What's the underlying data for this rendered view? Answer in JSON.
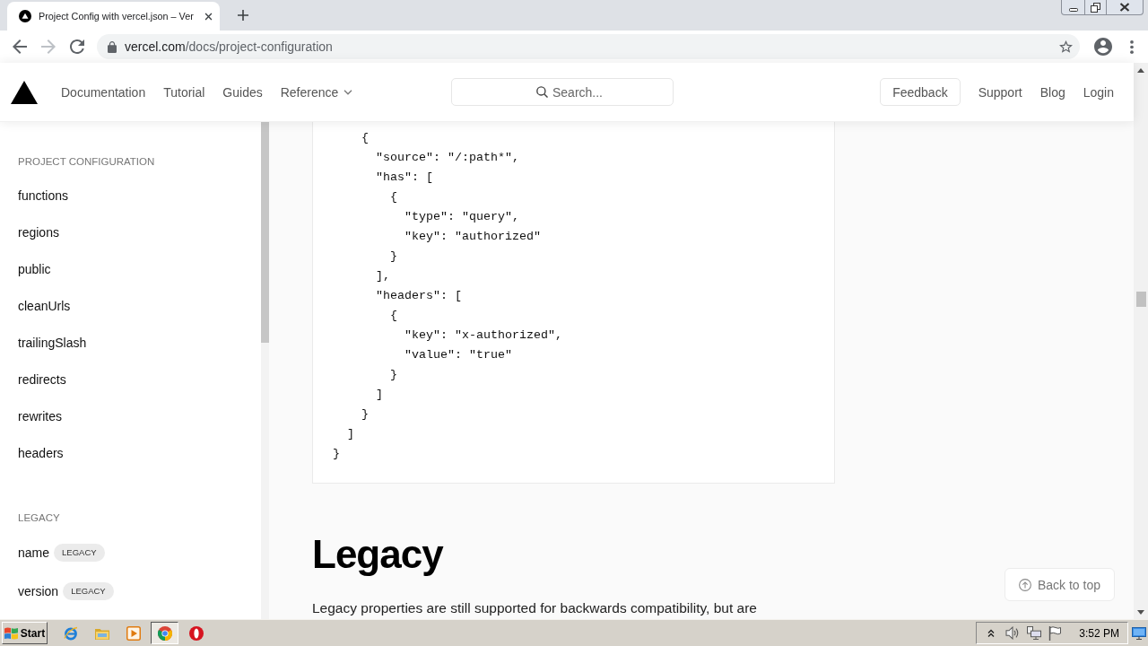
{
  "browser": {
    "tabs": [
      {
        "title": "Project Config with vercel.json – Ver",
        "selected": true
      }
    ],
    "nav_buttons": [
      {
        "disabled": false
      },
      {
        "disabled": true
      },
      {
        "disabled": false
      }
    ],
    "address": {
      "host": "vercel.com",
      "path": "/docs/project-configuration"
    }
  },
  "header": {
    "nav": [
      {
        "label": "Documentation",
        "dropdown": false
      },
      {
        "label": "Tutorial",
        "dropdown": false
      },
      {
        "label": "Guides",
        "dropdown": false
      },
      {
        "label": "Reference",
        "dropdown": true
      }
    ],
    "search": {
      "placeholder": "Search..."
    },
    "feedback": "Feedback",
    "links": [
      "Support",
      "Blog",
      "Login"
    ]
  },
  "sidebar": {
    "sections": [
      {
        "heading": "PROJECT CONFIGURATION",
        "items": [
          {
            "label": "functions"
          },
          {
            "label": "regions"
          },
          {
            "label": "public"
          },
          {
            "label": "cleanUrls"
          },
          {
            "label": "trailingSlash"
          },
          {
            "label": "redirects"
          },
          {
            "label": "rewrites"
          },
          {
            "label": "headers"
          }
        ]
      },
      {
        "heading": "LEGACY",
        "items": [
          {
            "label": "name",
            "badge": "LEGACY"
          },
          {
            "label": "version",
            "badge": "LEGACY"
          }
        ]
      }
    ]
  },
  "content": {
    "code_lines": [
      "    {",
      "      \"source\": \"/:path*\",",
      "      \"has\": [",
      "        {",
      "          \"type\": \"query\",",
      "          \"key\": \"authorized\"",
      "        }",
      "      ],",
      "      \"headers\": [",
      "        {",
      "          \"key\": \"x-authorized\",",
      "          \"value\": \"true\"",
      "        }",
      "      ]",
      "    }",
      "  ]",
      "}"
    ],
    "heading": "Legacy",
    "paragraph": "Legacy properties are still supported for backwards compatibility, but are",
    "back_to_top": "Back to top"
  },
  "taskbar": {
    "start": "Start",
    "buttons": [
      {
        "selected": false
      },
      {
        "selected": false
      },
      {
        "selected": false
      },
      {
        "selected": true
      },
      {
        "selected": false
      }
    ],
    "clock": "3:52 PM"
  }
}
